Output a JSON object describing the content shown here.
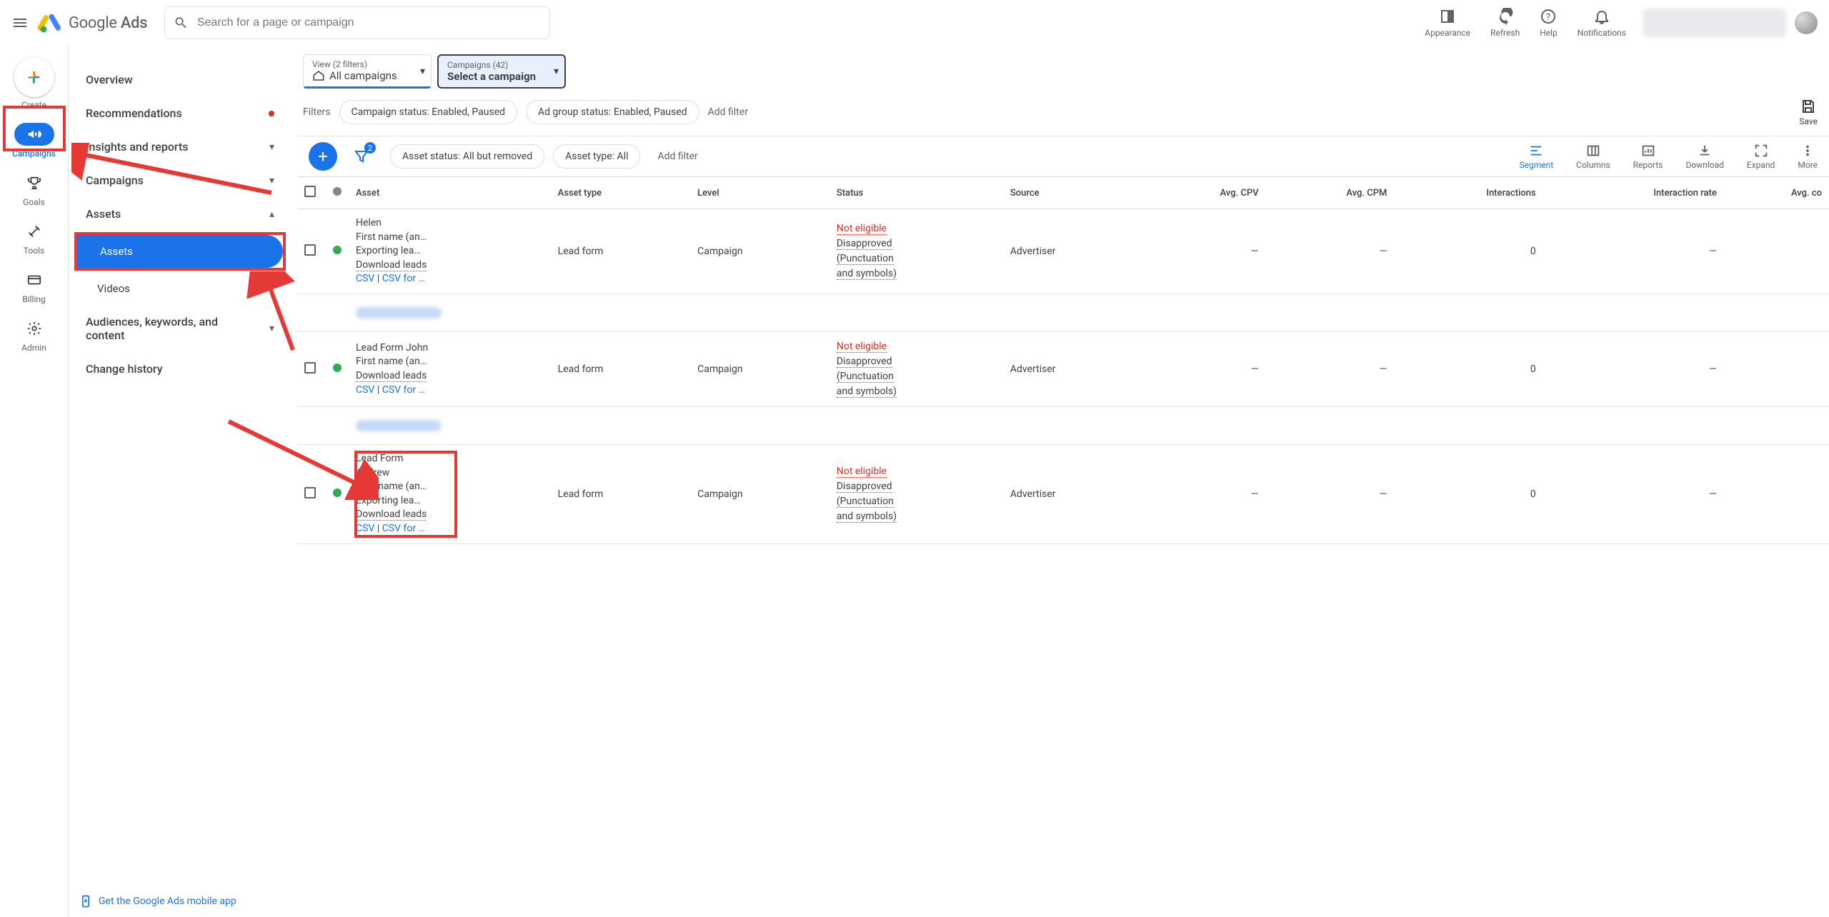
{
  "header": {
    "product": "Google",
    "product_sub": "Ads",
    "search_placeholder": "Search for a page or campaign",
    "actions": {
      "appearance": "Appearance",
      "refresh": "Refresh",
      "help": "Help",
      "notifications": "Notifications"
    }
  },
  "rail": {
    "create": "Create",
    "items": [
      {
        "id": "campaigns",
        "label": "Campaigns",
        "active": true
      },
      {
        "id": "goals",
        "label": "Goals"
      },
      {
        "id": "tools",
        "label": "Tools"
      },
      {
        "id": "billing",
        "label": "Billing"
      },
      {
        "id": "admin",
        "label": "Admin"
      }
    ]
  },
  "sidenav": {
    "items": {
      "overview": "Overview",
      "recommendations": "Recommendations",
      "insights": "Insights and reports",
      "campaigns": "Campaigns",
      "assets_parent": "Assets",
      "assets": "Assets",
      "videos": "Videos",
      "audiences": "Audiences, keywords, and content",
      "change_history": "Change history"
    },
    "mobile_app": "Get the Google Ads mobile app"
  },
  "selectors": {
    "view_top": "View (2 filters)",
    "view_bot": "All campaigns",
    "camp_top": "Campaigns (42)",
    "camp_bot": "Select a campaign"
  },
  "filters": {
    "label": "Filters",
    "campaign_status": "Campaign status: Enabled, Paused",
    "adgroup_status": "Ad group status: Enabled, Paused",
    "add": "Add filter",
    "save": "Save"
  },
  "toolbar": {
    "filter_badge": "2",
    "asset_status": "Asset status: All but removed",
    "asset_type": "Asset type: All",
    "addf": "Add filter",
    "actions": {
      "segment": "Segment",
      "columns": "Columns",
      "reports": "Reports",
      "download": "Download",
      "expand": "Expand",
      "more": "More"
    }
  },
  "table": {
    "headers": {
      "asset": "Asset",
      "asset_type": "Asset type",
      "level": "Level",
      "status": "Status",
      "source": "Source",
      "avg_cpv": "Avg. CPV",
      "avg_cpm": "Avg. CPM",
      "interactions": "Interactions",
      "interaction_rate": "Interaction rate",
      "avg_co": "Avg. co"
    },
    "common": {
      "download_leads": "Download leads",
      "csv": "CSV",
      "csv_for": "CSV for …",
      "asset_type_val": "Lead form",
      "level_val": "Campaign",
      "source_val": "Advertiser",
      "dash": "—",
      "zero": "0"
    },
    "status": {
      "not_eligible": "Not eligible",
      "disapproved": "Disapproved",
      "punct": "(Punctuation",
      "symbols": "and symbols)"
    },
    "rows": [
      {
        "l1": "Helen",
        "l2": "First name (an…",
        "l3": "Exporting lea…"
      },
      {
        "l1": "Lead Form John",
        "l2": "First name (an…",
        "l3": ""
      },
      {
        "l1": "Lead Form",
        "l1b": "Andrew",
        "l2": "First name (an…",
        "l3": "Exporting lea…"
      }
    ]
  }
}
